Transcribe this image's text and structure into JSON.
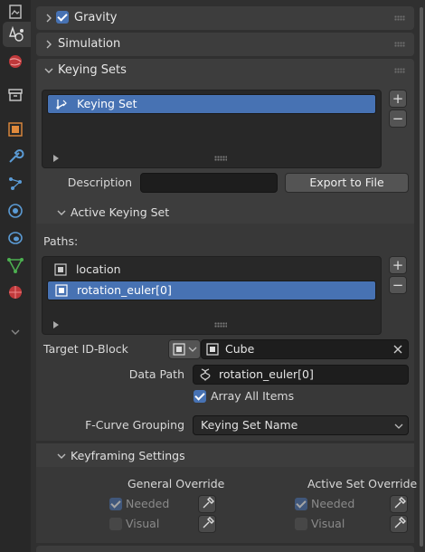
{
  "panels": {
    "gravity": {
      "title": "Gravity",
      "enabled": true
    },
    "simulation": {
      "title": "Simulation"
    },
    "keying_sets": {
      "title": "Keying Sets"
    }
  },
  "keying_sets": {
    "items": [
      "Keying Set"
    ],
    "description_label": "Description",
    "description_value": "",
    "export_button": "Export to File"
  },
  "active_keying_set": {
    "title": "Active Keying Set",
    "paths_label": "Paths:",
    "paths": [
      "location",
      "rotation_euler[0]"
    ],
    "target_id_label": "Target ID-Block",
    "target_id_value": "Cube",
    "data_path_label": "Data Path",
    "data_path_value": "rotation_euler[0]",
    "array_all_items_label": "Array All Items",
    "array_all_items": true,
    "fcurve_grouping_label": "F-Curve Grouping",
    "fcurve_grouping_value": "Keying Set Name"
  },
  "keyframing_settings": {
    "title": "Keyframing Settings",
    "general_override": "General Override",
    "active_set_override": "Active Set Override",
    "needed_label": "Needed",
    "visual_label": "Visual"
  },
  "list_buttons": {
    "add": "+",
    "remove": "−"
  },
  "colors": {
    "accent": "#4772b3",
    "panel": "#3d3d3d",
    "field": "#1d1d1d"
  }
}
